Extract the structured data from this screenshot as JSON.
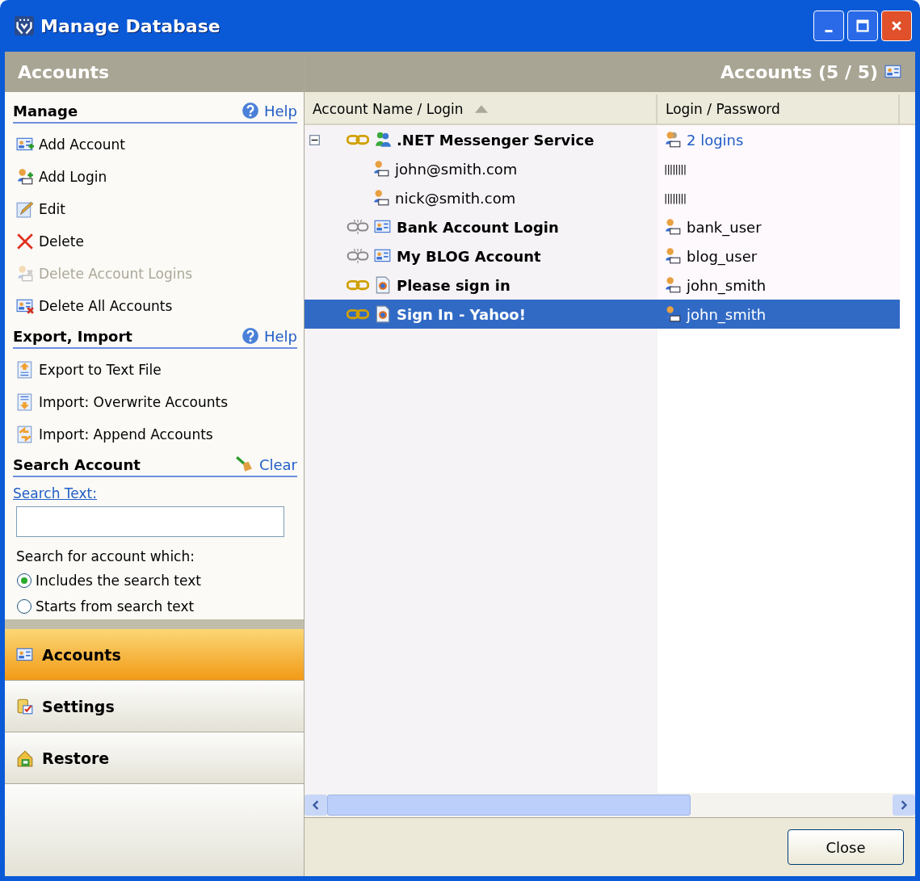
{
  "window": {
    "title": "Manage Database"
  },
  "left_header": "Accounts",
  "right_header": "Accounts (5 / 5)",
  "sections": [
    {
      "title": "Manage",
      "action": {
        "kind": "help",
        "label": "Help"
      },
      "items": [
        {
          "label": "Add Account",
          "disabled": false
        },
        {
          "label": "Add Login",
          "disabled": false
        },
        {
          "label": "Edit",
          "disabled": false
        },
        {
          "label": "Delete",
          "disabled": false
        },
        {
          "label": "Delete Account Logins",
          "disabled": true
        },
        {
          "label": "Delete All Accounts",
          "disabled": false
        }
      ]
    },
    {
      "title": "Export, Import",
      "action": {
        "kind": "help",
        "label": "Help"
      },
      "items": [
        {
          "label": "Export to Text File",
          "disabled": false
        },
        {
          "label": "Import: Overwrite Accounts",
          "disabled": false
        },
        {
          "label": "Import: Append Accounts",
          "disabled": false
        }
      ]
    },
    {
      "title": "Search Account",
      "action": {
        "kind": "clear",
        "label": "Clear"
      }
    }
  ],
  "search": {
    "label": "Search Text:",
    "mode_label": "Search for account which:",
    "options": [
      {
        "label": "Includes the search text",
        "selected": true
      },
      {
        "label": "Starts from search text",
        "selected": false
      }
    ]
  },
  "nav": [
    {
      "label": "Accounts",
      "selected": true
    },
    {
      "label": "Settings",
      "selected": false
    },
    {
      "label": "Restore",
      "selected": false
    }
  ],
  "table": {
    "columns": [
      "Account Name / Login",
      "Login / Password"
    ],
    "rows": [
      {
        "kind": "account",
        "name": ".NET Messenger Service",
        "linked": true,
        "login": "2 logins",
        "selected": false,
        "expanded": true,
        "children": [
          {
            "kind": "login",
            "name": "john@smith.com",
            "login": "||||||||",
            "selected": false
          },
          {
            "kind": "login",
            "name": "nick@smith.com",
            "login": "||||||||",
            "selected": false
          }
        ]
      },
      {
        "kind": "account",
        "name": "Bank Account Login",
        "linked": false,
        "login": "bank_user",
        "selected": false
      },
      {
        "kind": "account",
        "name": "My BLOG Account",
        "linked": false,
        "login": "blog_user",
        "selected": false
      },
      {
        "kind": "account",
        "name": "Please sign in",
        "linked": true,
        "login": "john_smith",
        "selected": false
      },
      {
        "kind": "account",
        "name": "Sign In - Yahoo!",
        "linked": true,
        "login": "john_smith",
        "selected": true
      }
    ]
  },
  "buttons": [
    "Close"
  ]
}
